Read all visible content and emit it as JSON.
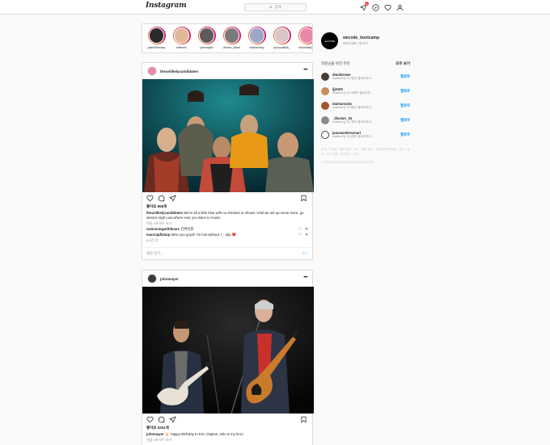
{
  "nav": {
    "logo": "Instagram",
    "search_placeholder": "검색",
    "notification_count": "1"
  },
  "stories": [
    {
      "name": "patrickbrioney",
      "color": "#2b2b2b"
    },
    {
      "name": "mietomo",
      "color": "#e0b89a"
    },
    {
      "name": "johnmayer",
      "color": "#5c5c5c"
    },
    {
      "name": "demon_baker",
      "color": "#7a7a7a"
    },
    {
      "name": "robintemmy",
      "color": "#9aa7c8"
    },
    {
      "name": "yuuuuukkkk_",
      "color": "#d8c7c4"
    },
    {
      "name": "theunlikelyca",
      "color": "#e889a6"
    }
  ],
  "posts": [
    {
      "user": "theunlikelycandidates",
      "likes": "좋아요 868개",
      "caption_user": "theunlikelycandidates",
      "caption_text": "We're all a little blue with no streams or shows. Until we set up some more, go stream High Low where ever you listen to music.",
      "view_comments": "댓글 4개 모두 보기",
      "comments": [
        {
          "user": "swimmingwithbears",
          "text": "진짜멋쟁"
        },
        {
          "user": "marciapflatarp",
          "text": "Miss you guys!! I'm lost without 🐑 day ❤️"
        }
      ],
      "time": "9시간 전",
      "add_comment_placeholder": "댓글 달기...",
      "post_button": "게시"
    },
    {
      "user": "johnmayer",
      "likes": "좋아요 5251개",
      "caption_user": "johnmayer",
      "caption_text": "🎂 Happy Birthday to Eric Clapton, who is my hero.",
      "view_comments": "댓글 4개 모두 보기",
      "comments": [],
      "time": "",
      "add_comment_placeholder": "",
      "post_button": ""
    }
  ],
  "sidebar": {
    "me": {
      "username": "wecode_bootcamp",
      "avatar_text": "weCODE",
      "sub": "WeCode | 위코드"
    },
    "suggest_title": "회원님을 위한 추천",
    "see_all": "모두 보기",
    "follow_label": "팔로우",
    "suggestions": [
      {
        "user": "dmmbrown",
        "sub": "wdelseri님 외 2명이 팔로우하고...",
        "color": "#4a3b30"
      },
      {
        "user": "ljj0100",
        "sub": "wdelseri님 외 10명이 팔로우하...",
        "color": "#c98a5e"
      },
      {
        "user": "damianscks",
        "sub": "wdelseri님 외 8명이 팔로우하고...",
        "color": "#a3552f"
      },
      {
        "user": "_illusion_33",
        "sub": "wdelseri님 외 7명이 팔로우하고...",
        "color": "#8a8a8a"
      },
      {
        "user": "janusandersonart",
        "sub": "wdelseri님 외 5명이 팔로우하고...",
        "color": "#ffffff"
      }
    ],
    "footer": "소개 · 도움말 · 홍보 센터 · API · 채용 정보 · 개인정보처리방침 · 약관 · 위치 · 인기 계정 · 해시태그 · 언어",
    "copyright": "© 2020 INSTAGRAM FROM FACEBOOK"
  }
}
